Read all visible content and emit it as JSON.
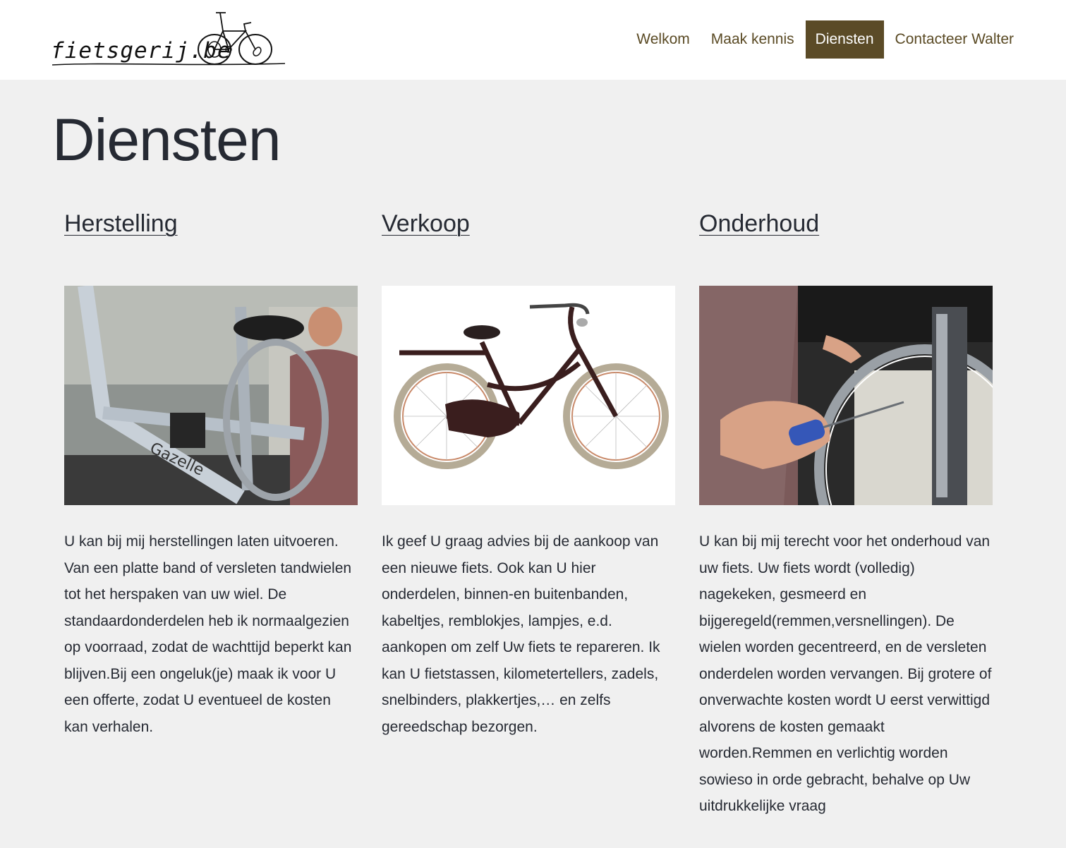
{
  "header": {
    "logo_text": "fietsgerij.be",
    "nav": [
      {
        "label": "Welkom",
        "active": false
      },
      {
        "label": "Maak kennis",
        "active": false
      },
      {
        "label": "Diensten",
        "active": true
      },
      {
        "label": "Contacteer Walter",
        "active": false
      }
    ]
  },
  "page": {
    "title": "Diensten"
  },
  "services": [
    {
      "title": "Herstelling",
      "image": "photo-mechanic-repairing-bicycle",
      "text": "U kan bij mij herstellingen laten uitvoeren. Van een platte band of versleten tandwielen tot het herspaken van uw wiel. De standaardonderdelen heb ik normaalgezien op voorraad, zodat de wachttijd beperkt kan blijven.Bij een ongeluk(je) maak ik voor U een offerte, zodat U eventueel de kosten kan verhalen."
    },
    {
      "title": "Verkoop",
      "image": "photo-city-bicycle",
      "text": "Ik geef U graag advies bij de aankoop van een nieuwe fiets. Ook kan U hier onderdelen, binnen-en buitenbanden, kabeltjes, remblokjes, lampjes, e.d. aankopen om zelf Uw fiets te repareren.  Ik kan U fietstassen, kilometertellers, zadels, snelbinders, plakkertjes,… en zelfs gereedschap bezorgen."
    },
    {
      "title": "Onderhoud",
      "image": "photo-hand-adjusting-wheel",
      "text": "U kan bij mij terecht voor het onderhoud van uw fiets.  Uw fiets wordt (volledig) nagekeken, gesmeerd en bijgeregeld(remmen,versnellingen).  De wielen worden gecentreerd, en de versleten onderdelen worden vervangen.  Bij grotere of onverwachte kosten wordt U eerst verwittigd alvorens de kosten gemaakt worden.Remmen en verlichtig worden sowieso in orde gebracht, behalve op Uw uitdrukkelijke vraag"
    }
  ],
  "colors": {
    "background": "#f0f0f0",
    "header_bg": "#ffffff",
    "nav_active_bg": "#5b4b27",
    "nav_text": "#5a4a24",
    "body_text": "#262a33"
  }
}
